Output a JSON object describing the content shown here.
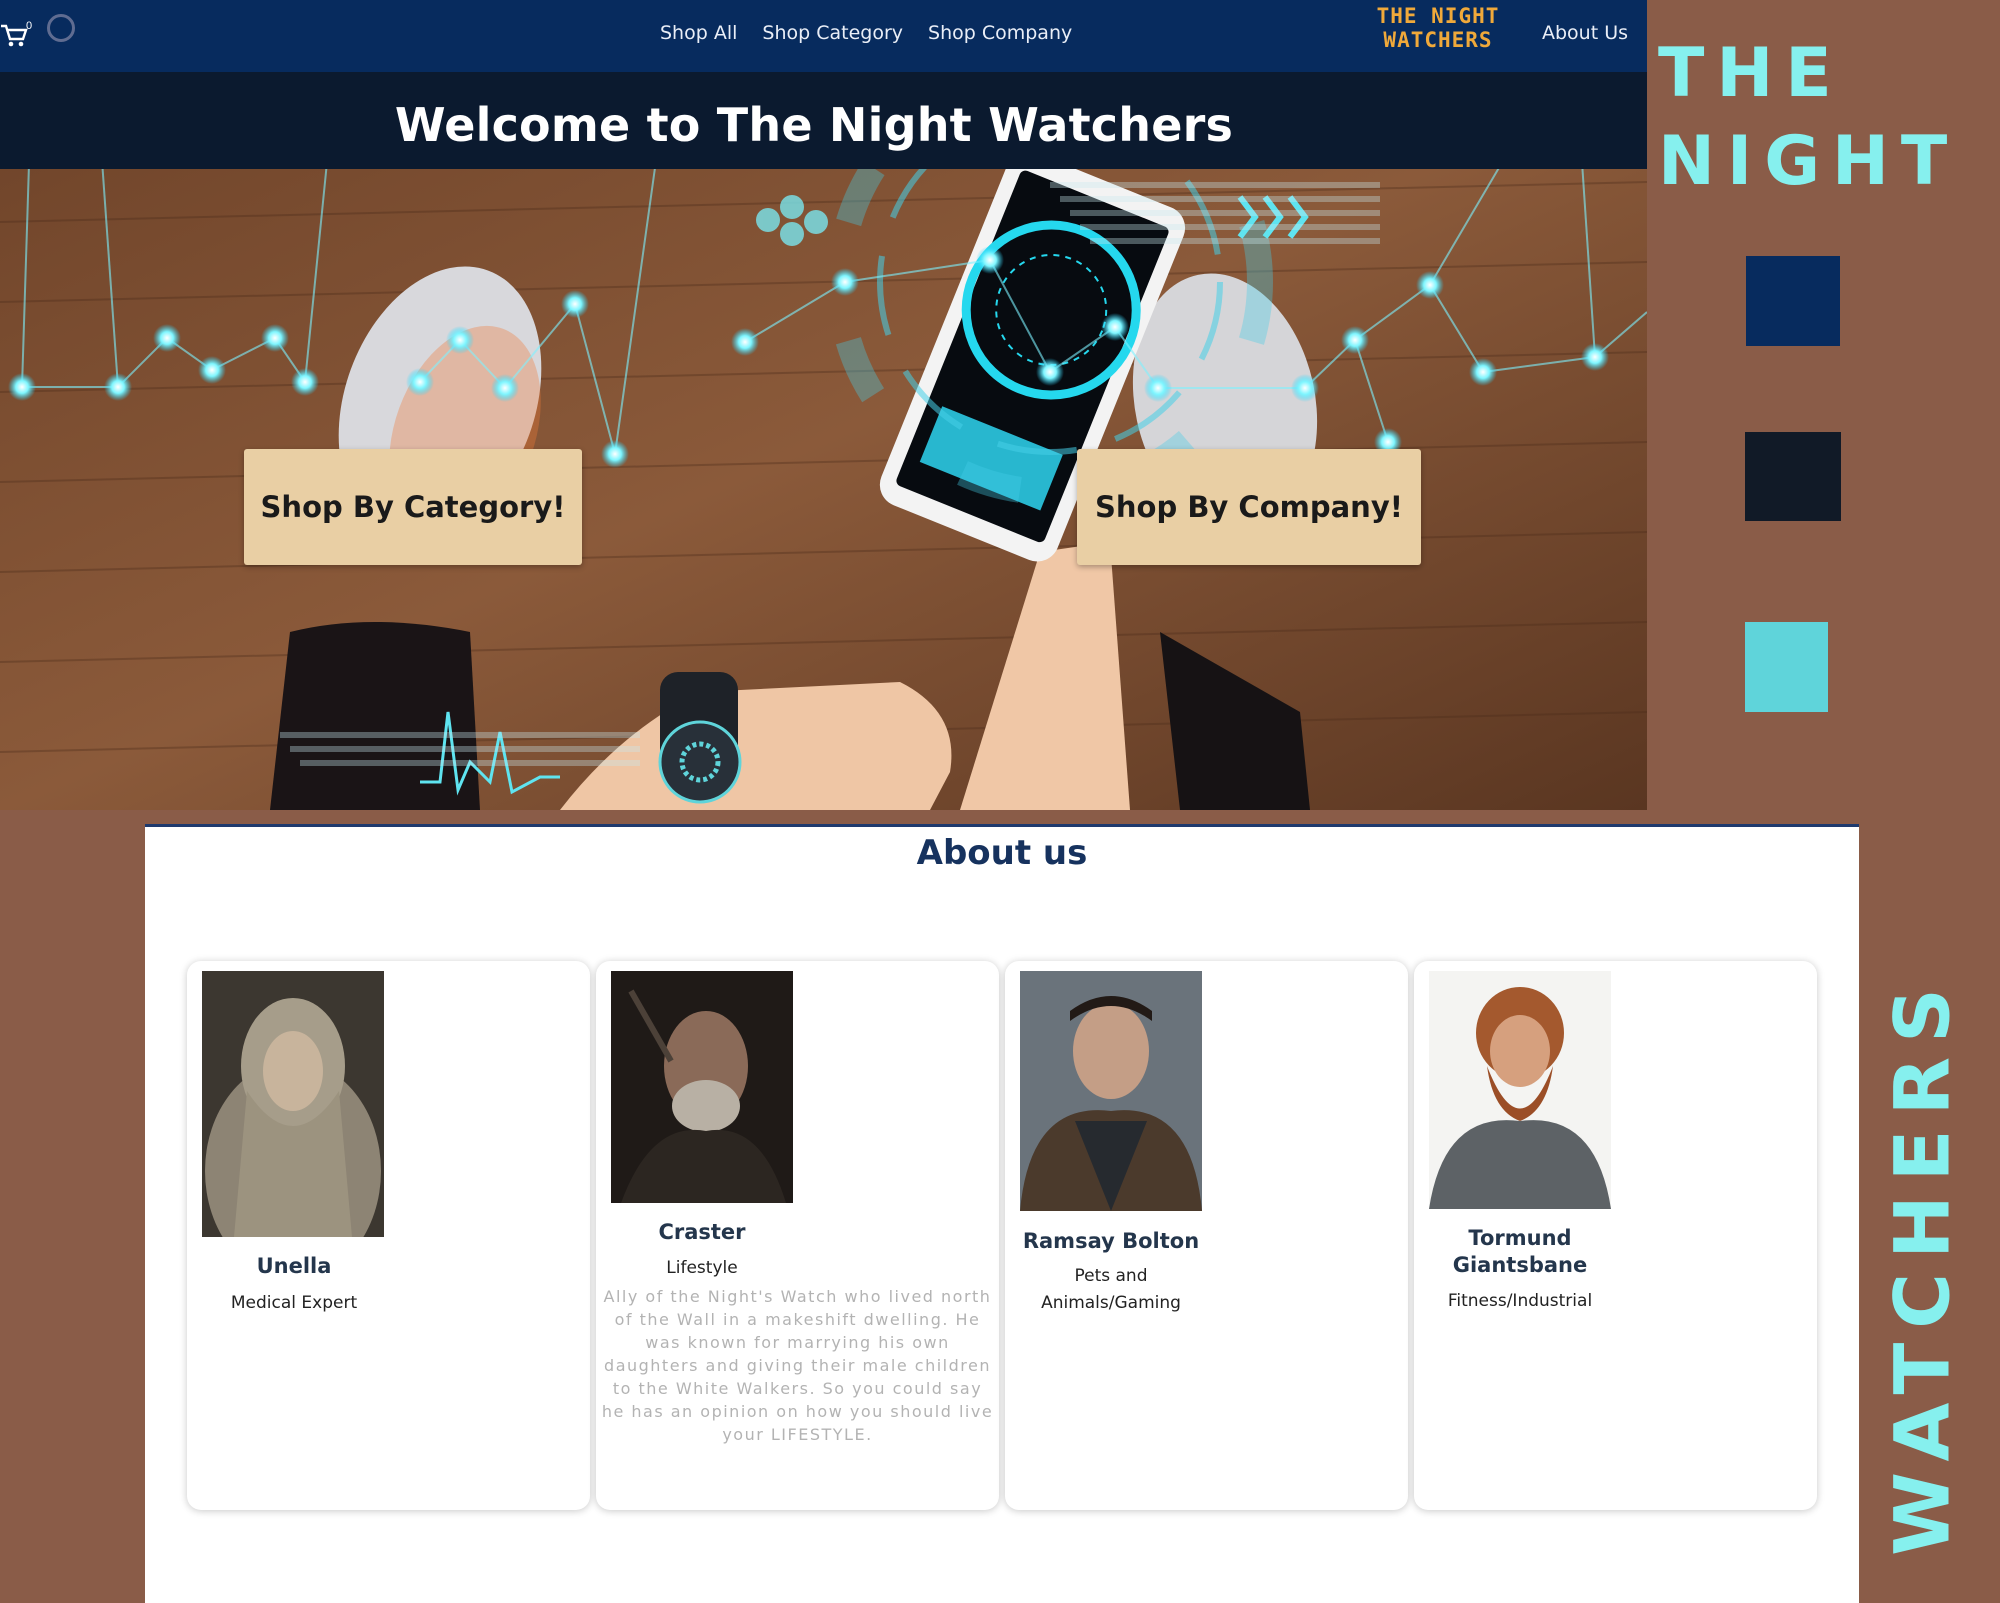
{
  "nav": {
    "cart_count": "0",
    "links": [
      "Shop All",
      "Shop Category",
      "Shop Company"
    ],
    "logo_line1": "THE NIGHT",
    "logo_line2": "WATCHERS",
    "about_link": "About Us"
  },
  "hero": {
    "title": "Welcome to The Night Watchers",
    "btn_category": "Shop By Category!",
    "btn_company": "Shop By Company!"
  },
  "brand": {
    "side_line1": "THE",
    "side_line2": "NIGHT",
    "side_vertical": "WATCHERS",
    "colors": {
      "navy": "#072b5e",
      "dark": "#111a27",
      "cyan": "#5fd4da",
      "brown": "#8a5c48",
      "sand": "#e9cfa4"
    }
  },
  "about": {
    "heading": "About us",
    "members": [
      {
        "name": "Unella",
        "role": "Medical Expert",
        "bio": ""
      },
      {
        "name": "Craster",
        "role": "Lifestyle",
        "bio": "Ally of the Night's Watch who lived north of the Wall in a makeshift dwelling. He was known for marrying his own daughters and giving their male children to the White Walkers. So you could say he has an opinion on how you should live your LIFESTYLE."
      },
      {
        "name": "Ramsay Bolton",
        "role": "Pets and Animals/Gaming",
        "bio": ""
      },
      {
        "name": "Tormund Giantsbane",
        "role": "Fitness/Industrial",
        "bio": ""
      }
    ]
  },
  "icons": {
    "cart": "shopping-cart-icon",
    "account": "circle-icon"
  }
}
